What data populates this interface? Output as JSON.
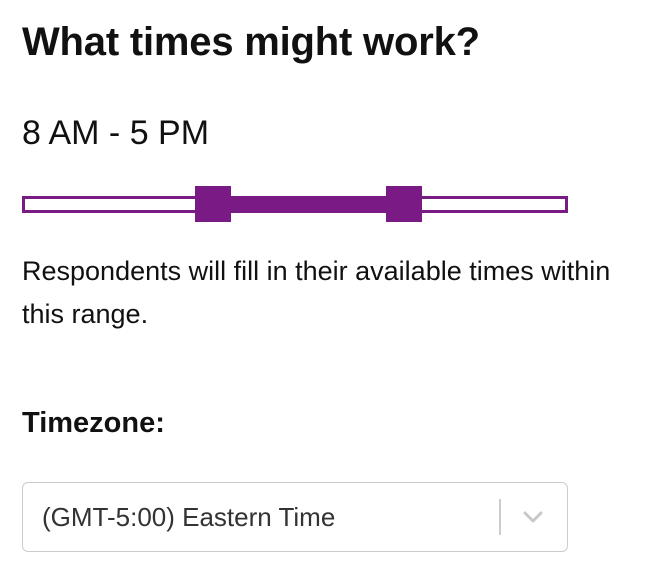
{
  "question": {
    "title": "What times might work?"
  },
  "time_range": {
    "label": "8 AM - 5 PM",
    "start_fraction": 0.35,
    "end_fraction": 0.7
  },
  "help": {
    "text": "Respondents will fill in their available times within this range."
  },
  "timezone": {
    "label": "Timezone:",
    "selected": "(GMT-5:00) Eastern Time",
    "dropdown_icon": "chevron-down-icon"
  },
  "colors": {
    "accent": "#7a1a85",
    "border": "#cccccc"
  }
}
